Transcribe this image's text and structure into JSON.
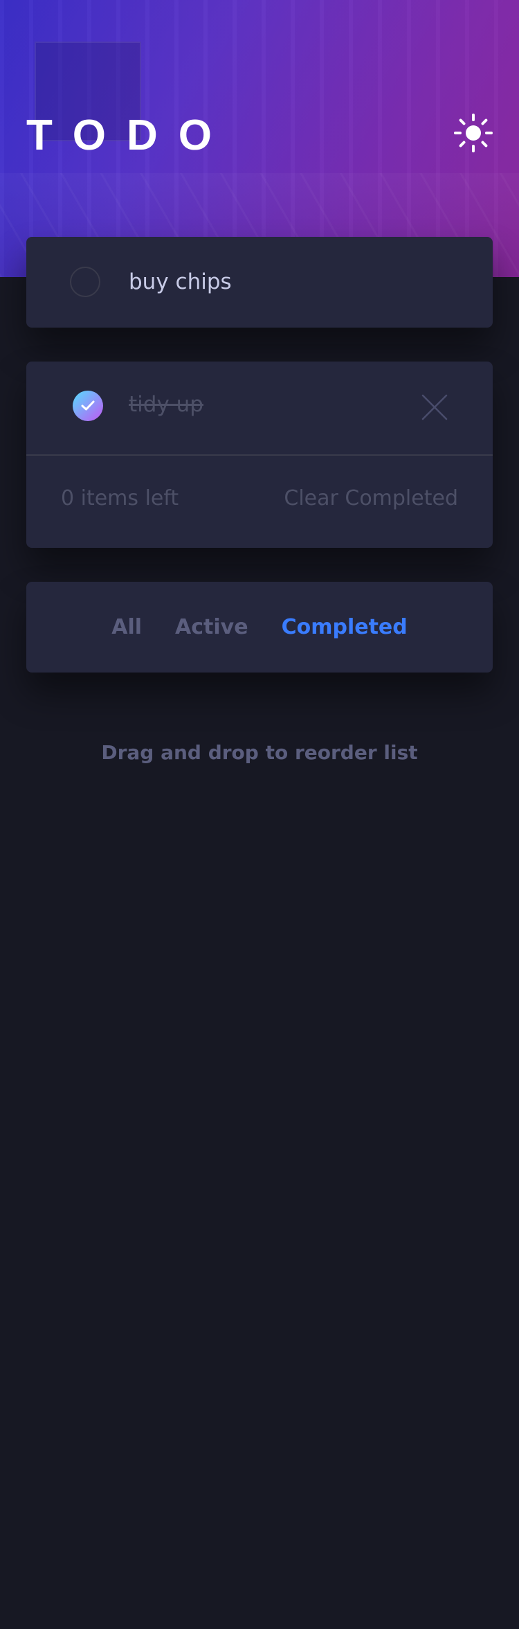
{
  "header": {
    "title": "TODO",
    "theme_toggle_icon": "sun-icon"
  },
  "new_todo": {
    "value": "buy chips",
    "checkbox_icon": "empty-circle-icon"
  },
  "todos": [
    {
      "text": "tidy up",
      "completed": true,
      "check_icon": "check-icon",
      "delete_icon": "cross-icon"
    }
  ],
  "footer": {
    "items_left": "0 items left",
    "clear_label": "Clear Completed"
  },
  "filters": {
    "all": "All",
    "active": "Active",
    "completed": "Completed",
    "selected": "Completed"
  },
  "hint": "Drag and drop to reorder list",
  "colors": {
    "background": "#171823",
    "card": "#25273d",
    "accent": "#3a7cfd",
    "check_gradient_start": "#55ddff",
    "check_gradient_end": "#c058f3",
    "muted_text": "#4d5067",
    "text": "#c8cbe7"
  }
}
